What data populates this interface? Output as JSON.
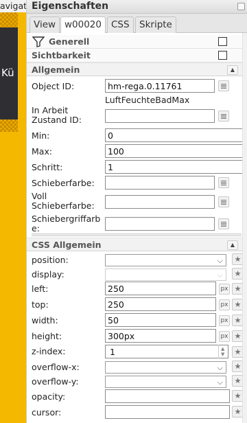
{
  "left_panel": {
    "top_text": "avigat",
    "dark_text": "Kü"
  },
  "panel": {
    "title": "Eigenschaften",
    "tabs": [
      "View",
      "w00020",
      "CSS",
      "Skripte"
    ]
  },
  "groups": {
    "generell": "Generell",
    "sichtbarkeit": "Sichtbarkeit",
    "allgemein": "Allgemein",
    "css_allgemein": "CSS Allgemein"
  },
  "allgemein": {
    "object_id_label": "Object ID:",
    "object_id_value": "hm-rega.0.11761",
    "object_id_name": "LuftFeuchteBadMax",
    "in_arbeit_label": "In Arbeit Zustand ID:",
    "in_arbeit_value": "",
    "min_label": "Min:",
    "min_value": "0",
    "max_label": "Max:",
    "max_value": "100",
    "schritt_label": "Schritt:",
    "schritt_value": "1",
    "schieberfarbe_label": "Schieberfarbe:",
    "schieberfarbe_value": "",
    "voll_label": "Voll Schieberfarbe:",
    "voll_value": "",
    "griff_label": "Schiebergriffarbe:",
    "griff_value": ""
  },
  "css": {
    "position_label": "position:",
    "position_value": "",
    "display_label": "display:",
    "display_value": "",
    "left_label": "left:",
    "left_value": "250",
    "top_label": "top:",
    "top_value": "250",
    "width_label": "width:",
    "width_value": "50",
    "height_label": "height:",
    "height_value": "300px",
    "zindex_label": "z-index:",
    "zindex_value": "1",
    "overflowx_label": "overflow-x:",
    "overflowx_value": "",
    "overflowy_label": "overflow-y:",
    "overflowy_value": "",
    "opacity_label": "opacity:",
    "opacity_value": "",
    "cursor_label": "cursor:",
    "cursor_value": "",
    "unit": "px"
  },
  "icons": {
    "filter": "funnel-icon",
    "collapse": "chevron-up-icon",
    "select": "chevron-down-icon",
    "star": "star-icon",
    "grid": "grid-icon"
  }
}
